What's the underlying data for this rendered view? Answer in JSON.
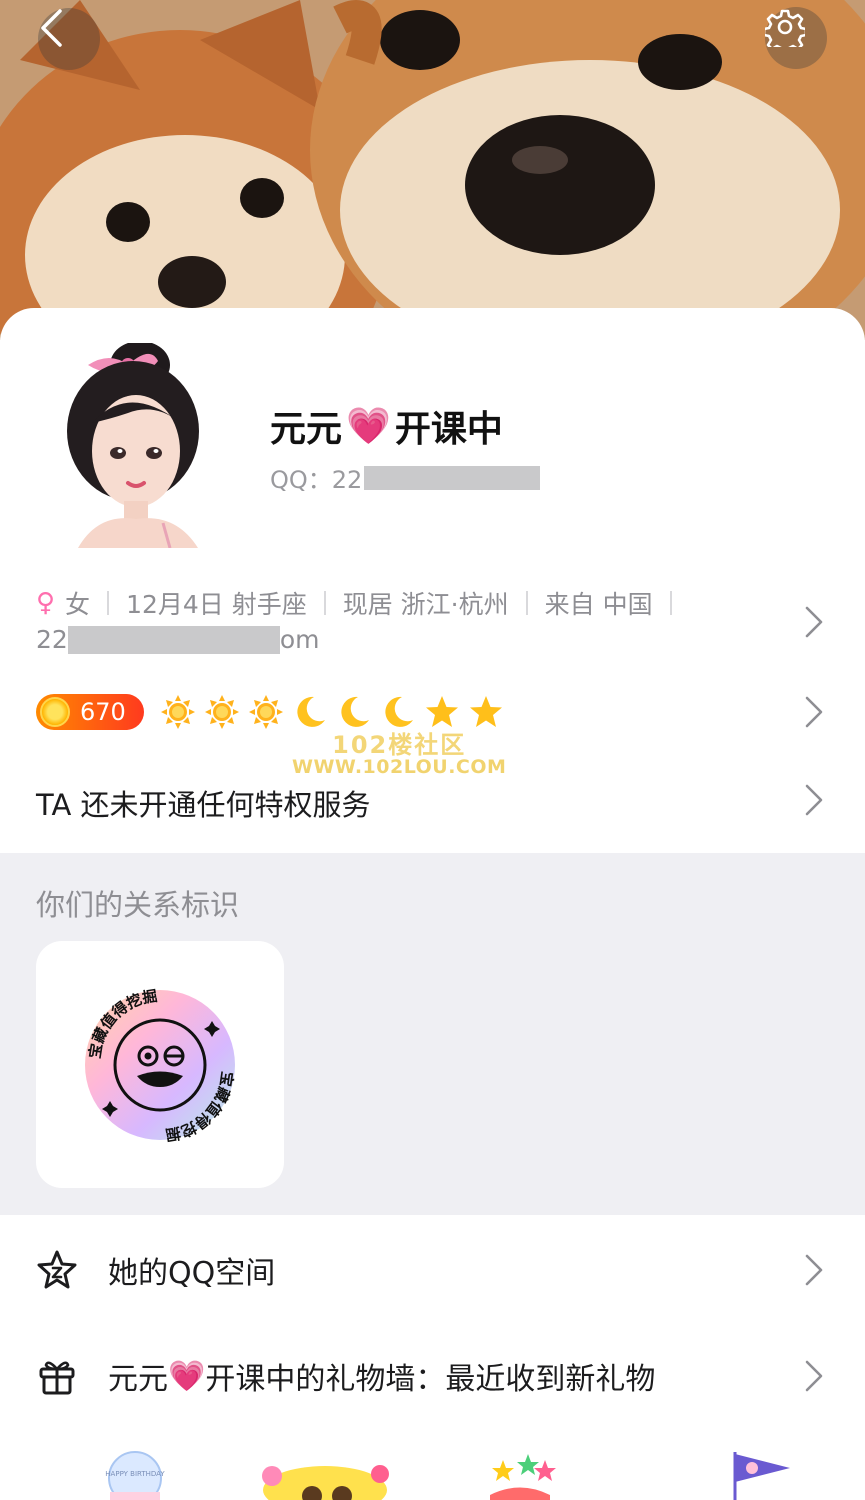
{
  "profile": {
    "name_part1": "元元",
    "name_emoji": "💗",
    "name_part2": "开课中",
    "qq_label": "QQ：22",
    "gender_symbol": "♀",
    "gender": "女",
    "birthday": "12月4日 射手座",
    "location": "现居 浙江·杭州",
    "hometown": "来自 中国",
    "email_prefix": "22",
    "email_suffix": "om"
  },
  "level": {
    "value": "670",
    "icons": [
      "sun-icon",
      "sun-icon",
      "sun-icon",
      "moon-icon",
      "moon-icon",
      "moon-icon",
      "star-icon",
      "star-icon"
    ]
  },
  "watermark": {
    "line1": "102楼社区",
    "line2": "WWW.102LOU.COM"
  },
  "vip": {
    "text": "TA 还未开通任何特权服务"
  },
  "relationship": {
    "title": "你们的关系标识",
    "badge_text": "宝藏值得挖掘"
  },
  "list": {
    "qzone_label": "她的QQ空间",
    "gift_part1": "元元",
    "gift_emoji": "💗",
    "gift_part2": "开课中的礼物墙：最近收到新礼物"
  },
  "gifts": {
    "cake_text": "HAPPY BIRTHDAY"
  },
  "colors": {
    "accent_female": "#ff6fae",
    "level_badge": "#ff5a14",
    "section_bg": "#efeff3"
  }
}
